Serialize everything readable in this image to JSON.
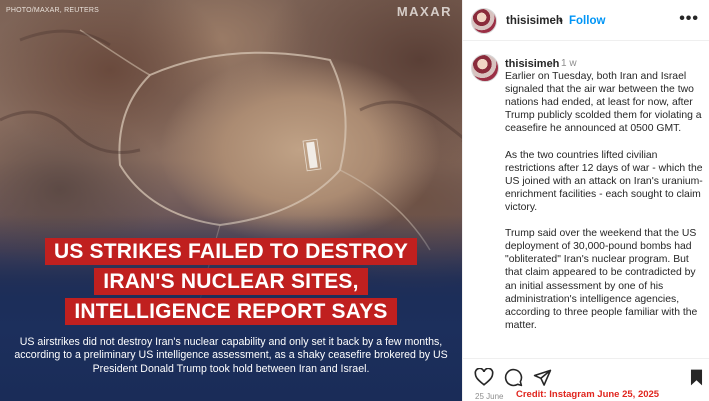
{
  "image": {
    "photo_credit": "PHOTO/MAXAR, REUTERS",
    "logo_text": "MAXAR",
    "headline_lines": [
      "US STRIKES FAILED TO DESTROY",
      "IRAN'S NUCLEAR SITES,",
      "INTELLIGENCE REPORT SAYS"
    ],
    "caption": "US airstrikes did not destroy Iran's nuclear capability and only set it back by a few months, according to a preliminary US intelligence assessment, as a shaky ceasefire brokered by US President Donald Trump took hold between Iran and Israel."
  },
  "header": {
    "username": "thisisimeh",
    "separator": "•",
    "follow_label": "Follow",
    "more_label": "•••"
  },
  "post": {
    "username": "thisisimeh",
    "time_ago": "1 w",
    "paragraphs": [
      "Earlier on Tuesday, both Iran and Israel signaled that the air war between the two nations had ended, at least for now, after Trump publicly scolded them for violating a ceasefire he announced at 0500 GMT.",
      "As the two countries lifted civilian restrictions after 12 days of war - which the US joined with an attack on Iran's uranium-enrichment facilities - each sought to claim victory.",
      "Trump said over the weekend that the US deployment of 30,000-pound bombs had \"obliterated\" Iran's nuclear program. But that claim appeared to be contradicted by an initial assessment by one of his administration's intelligence agencies, according to three people familiar with the matter."
    ]
  },
  "footer": {
    "date": "25 June",
    "credit": "Credit: Instagram June 25, 2025",
    "icons": [
      "heart-icon",
      "comment-icon",
      "share-icon",
      "bookmark-icon"
    ]
  },
  "colors": {
    "headline_red": "#c0201f",
    "follow_blue": "#0095f6",
    "credit_red": "#e0251e"
  }
}
